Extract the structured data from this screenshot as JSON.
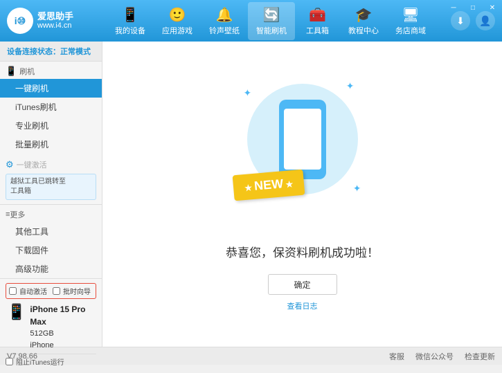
{
  "app": {
    "title": "爱思助手",
    "subtitle": "www.i4.cn"
  },
  "window_controls": {
    "minimize": "─",
    "maximize": "□",
    "close": "✕"
  },
  "nav": {
    "items": [
      {
        "id": "my-device",
        "icon": "📱",
        "label": "我的设备"
      },
      {
        "id": "apps-games",
        "icon": "👤",
        "label": "应用游戏"
      },
      {
        "id": "ringtones",
        "icon": "🔔",
        "label": "铃声壁纸"
      },
      {
        "id": "smart-flash",
        "icon": "🔄",
        "label": "智能刷机",
        "active": true
      },
      {
        "id": "toolbox",
        "icon": "🧰",
        "label": "工具箱"
      },
      {
        "id": "tutorials",
        "icon": "🎓",
        "label": "教程中心"
      },
      {
        "id": "service",
        "icon": "🖥",
        "label": "务店商域"
      }
    ],
    "download_icon": "⬇",
    "profile_icon": "👤"
  },
  "sidebar": {
    "status_label": "设备连接状态：",
    "status_value": "正常模式",
    "flash_section": {
      "icon": "📱",
      "label": "刷机"
    },
    "items": [
      {
        "id": "one-click-flash",
        "label": "一键刷机",
        "active": true
      },
      {
        "id": "itunes-flash",
        "label": "iTunes刷机",
        "active": false
      },
      {
        "id": "pro-flash",
        "label": "专业刷机",
        "active": false
      },
      {
        "id": "batch-flash",
        "label": "批量刷机",
        "active": false
      }
    ],
    "one_click_activate": {
      "icon": "⚙",
      "label": "一键激活",
      "disabled": true
    },
    "warning_text": "越狱工具已跳转至\n工具箱",
    "more_section": {
      "icon": "≡",
      "label": "更多"
    },
    "more_items": [
      {
        "id": "other-tools",
        "label": "其他工具"
      },
      {
        "id": "download-firmware",
        "label": "下载固件"
      },
      {
        "id": "advanced",
        "label": "高级功能"
      }
    ],
    "auto_activate": {
      "label": "自动激活",
      "checked": false
    },
    "scheduled_restart": {
      "label": "批时向导",
      "checked": false
    },
    "device": {
      "name": "iPhone 15 Pro Max",
      "storage": "512GB",
      "type": "iPhone"
    },
    "stop_itunes": {
      "label": "阻止iTunes运行",
      "checked": false
    }
  },
  "main": {
    "new_badge": "NEW",
    "success_message": "恭喜您，保资料刷机成功啦！",
    "confirm_button": "确定",
    "view_log": "查看日志"
  },
  "footer": {
    "version": "V7.98.66",
    "links": [
      {
        "id": "official-website",
        "label": "客服"
      },
      {
        "id": "wechat",
        "label": "微信公众号"
      },
      {
        "id": "check-update",
        "label": "检查更新"
      }
    ]
  }
}
